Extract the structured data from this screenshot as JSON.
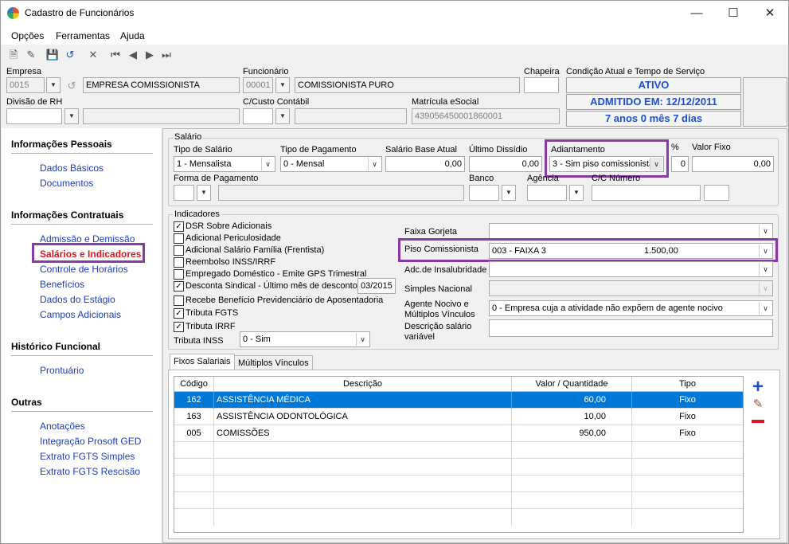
{
  "window": {
    "title": "Cadastro de Funcionários"
  },
  "menu": [
    "Opções",
    "Ferramentas",
    "Ajuda"
  ],
  "header": {
    "empresa_label": "Empresa",
    "empresa_code": "0015",
    "empresa_name": "EMPRESA COMISSIONISTA",
    "funcionario_label": "Funcionário",
    "funcionario_code": "00001",
    "funcionario_name": "COMISSIONISTA PURO",
    "chapeira_label": "Chapeira",
    "chapeira_value": "",
    "divisao_label": "Divisão de RH",
    "ccusto_label": "C/Custo Contábil",
    "matricula_label": "Matrícula eSocial",
    "matricula_value": "439056450001860001",
    "condicao_label": "Condição Atual e Tempo de Serviço",
    "status_ativo": "ATIVO",
    "status_admitido": "ADMITIDO EM: 12/12/2011",
    "status_tempo": "7 anos 0 mês 7 dias"
  },
  "sidebar": {
    "sections": [
      {
        "title": "Informações Pessoais",
        "items": [
          "Dados Básicos",
          "Documentos"
        ]
      },
      {
        "title": "Informações Contratuais",
        "items": [
          "Admissão e Demissão",
          "Salários e Indicadores",
          "Controle de Horários",
          "Benefícios",
          "Dados do Estágio",
          "Campos Adicionais"
        ]
      },
      {
        "title": "Histórico Funcional",
        "items": [
          "Prontuário"
        ]
      },
      {
        "title": "Outras",
        "items": [
          "Anotações",
          "Integração Prosoft GED",
          "Extrato FGTS Simples",
          "Extrato FGTS Rescisão"
        ]
      }
    ]
  },
  "salario": {
    "group_title": "Salário",
    "tipo_label": "Tipo de Salário",
    "tipo_value": "1 - Mensalista",
    "pagamento_label": "Tipo de Pagamento",
    "pagamento_value": "0 - Mensal",
    "base_label": "Salário Base Atual",
    "base_value": "0,00",
    "dissidio_label": "Último Dissídio",
    "dissidio_value": "0,00",
    "adiantamento_label": "Adiantamento",
    "adiantamento_value": "3 - Sim piso comissionista",
    "percent_label": "%",
    "percent_value": "0",
    "valorfixo_label": "Valor Fixo",
    "valorfixo_value": "0,00",
    "forma_label": "Forma de Pagamento",
    "banco_label": "Banco",
    "agencia_label": "Agência",
    "cc_label": "C/C Número"
  },
  "indicadores": {
    "group_title": "Indicadores",
    "checks": [
      {
        "label": "DSR Sobre Adicionais",
        "checked": true
      },
      {
        "label": "Adicional Periculosidade",
        "checked": false
      },
      {
        "label": "Adicional Salário Família (Frentista)",
        "checked": false
      },
      {
        "label": "Reembolso INSS/IRRF",
        "checked": false
      },
      {
        "label": "Empregado Doméstico - Emite GPS Trimestral",
        "checked": false
      },
      {
        "label": "Desconta Sindical - Último mês de desconto",
        "checked": true
      },
      {
        "label": "Recebe Benefício Previdenciário de Aposentadoria",
        "checked": false
      },
      {
        "label": "Tributa FGTS",
        "checked": true
      },
      {
        "label": "Tributa IRRF",
        "checked": true
      }
    ],
    "sindical_mes": "03/2015",
    "tributa_inss_label": "Tributa INSS",
    "tributa_inss_value": "0 - Sim",
    "faixa_gorjeta_label": "Faixa Gorjeta",
    "piso_label": "Piso Comissionista",
    "piso_value": "003 - FAIXA 3",
    "piso_amount": "1.500,00",
    "insalubridade_label": "Adc.de Insalubridade",
    "simples_label": "Simples Nacional",
    "agente_label_1": "Agente Nocivo e",
    "agente_label_2": "Múltiplos Vínculos",
    "agente_value": "0 - Empresa cuja a atividade não expõem de agente nocivo",
    "descricao_label_1": "Descrição salário",
    "descricao_label_2": "variável"
  },
  "tabs": [
    "Fixos Salariais",
    "Múltiplos Vínculos"
  ],
  "grid": {
    "headers": [
      "Código",
      "Descrição",
      "Valor / Quantidade",
      "Tipo"
    ],
    "rows": [
      {
        "codigo": "162",
        "descricao": "ASSISTÊNCIA MÉDICA",
        "valor": "60,00",
        "tipo": "Fixo"
      },
      {
        "codigo": "163",
        "descricao": "ASSISTÊNCIA ODONTOLÓGICA",
        "valor": "10,00",
        "tipo": "Fixo"
      },
      {
        "codigo": "005",
        "descricao": "COMISSÕES",
        "valor": "950,00",
        "tipo": "Fixo"
      }
    ]
  }
}
